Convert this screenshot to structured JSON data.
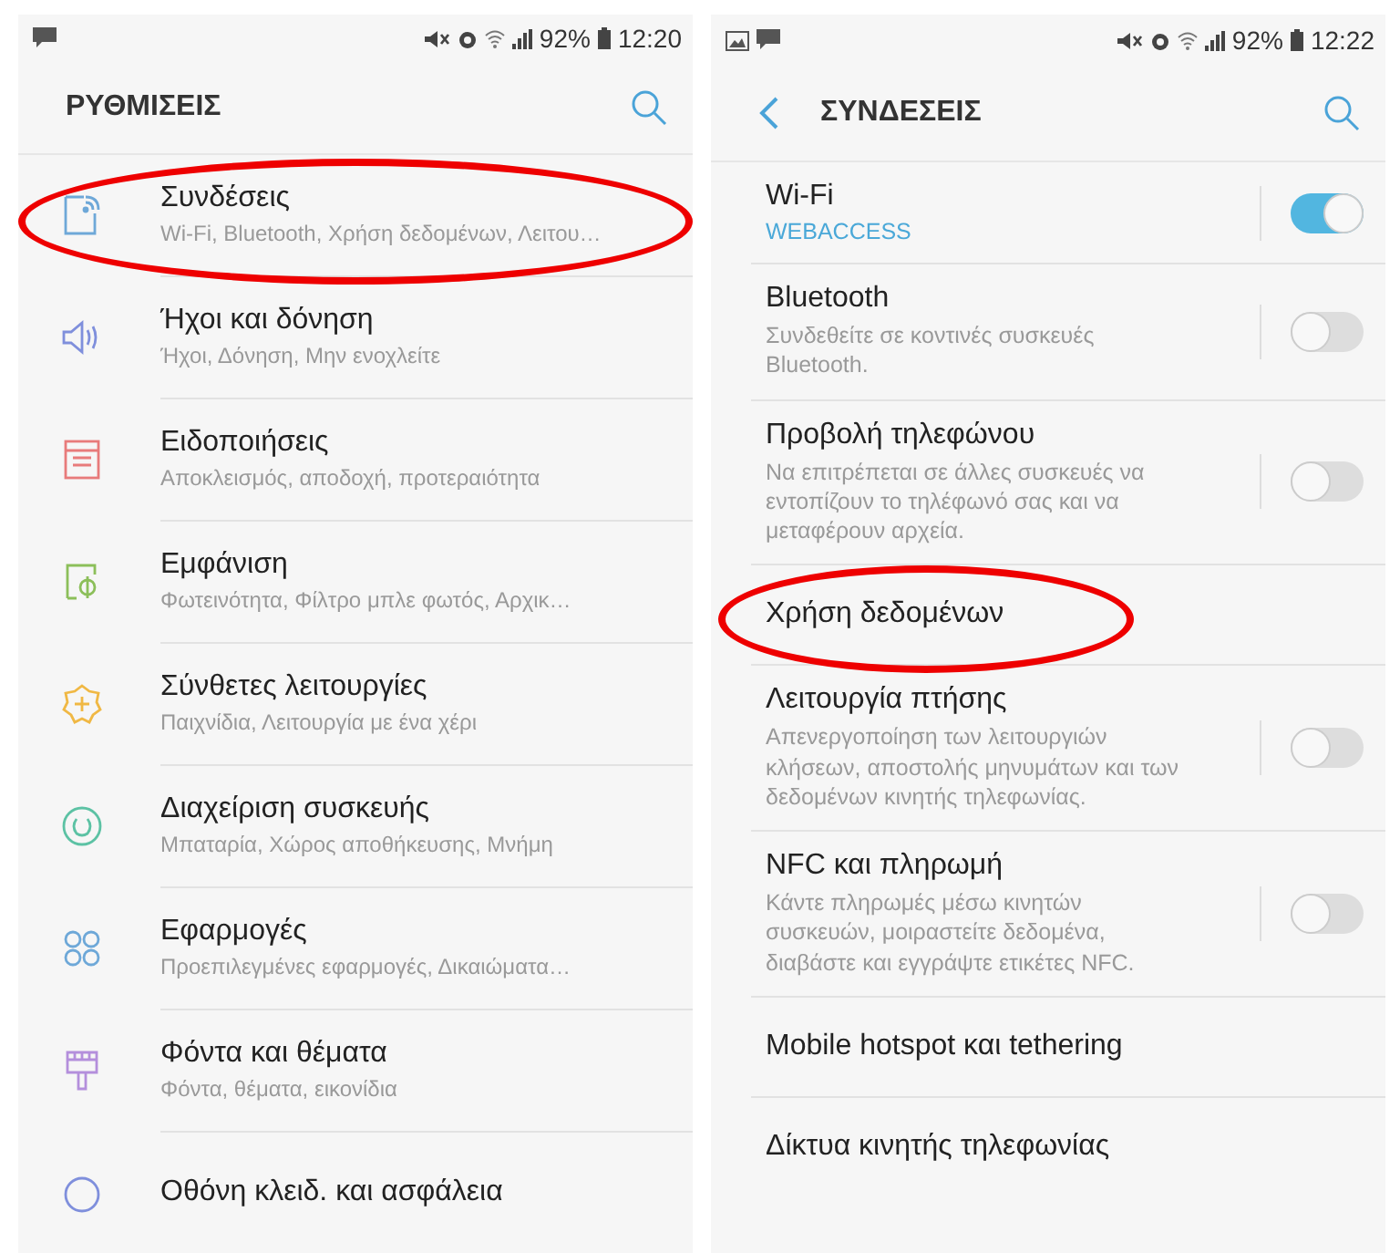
{
  "screens": [
    {
      "status_bar": {
        "battery": "92%",
        "time": "12:20",
        "image_notification": false
      },
      "header": {
        "title": "ΡΥΘΜΙΣΕΙΣ",
        "back": false
      },
      "items": [
        {
          "kind": "category",
          "title": "Συνδέσεις",
          "description": "Wi-Fi, Bluetooth, Χρήση δεδομένων, Λειτου…",
          "color": "#6ea8d8",
          "highlighted": true
        },
        {
          "kind": "category",
          "title": "Ήχοι και δόνηση",
          "description": "Ήχοι, Δόνηση, Μην ενοχλείτε",
          "color": "#7f8fdc",
          "highlighted": false
        },
        {
          "kind": "category",
          "title": "Ειδοποιήσεις",
          "description": "Αποκλεισμός, αποδοχή, προτεραιότητα",
          "color": "#e87b7b",
          "highlighted": false
        },
        {
          "kind": "category",
          "title": "Εμφάνιση",
          "description": "Φωτεινότητα, Φίλτρο μπλε φωτός, Αρχικ…",
          "color": "#8cbf5a",
          "highlighted": false
        },
        {
          "kind": "category",
          "title": "Σύνθετες λειτουργίες",
          "description": "Παιχνίδια, Λειτουργία με ένα χέρι",
          "color": "#f0b844",
          "highlighted": false
        },
        {
          "kind": "category",
          "title": "Διαχείριση συσκευής",
          "description": "Μπαταρία, Χώρος αποθήκευσης, Μνήμη",
          "color": "#5cc2a4",
          "highlighted": false
        },
        {
          "kind": "category",
          "title": "Εφαρμογές",
          "description": "Προεπιλεγμένες εφαρμογές, Δικαιώματα…",
          "color": "#6ea8d8",
          "highlighted": false
        },
        {
          "kind": "category",
          "title": "Φόντα και θέματα",
          "description": "Φόντα, θέματα, εικονίδια",
          "color": "#b48fdc",
          "highlighted": false
        },
        {
          "kind": "category",
          "title": "Οθόνη κλειδ. και ασφάλεια",
          "color": "#7f8fdc",
          "highlighted": false
        }
      ]
    },
    {
      "status_bar": {
        "battery": "92%",
        "time": "12:22",
        "image_notification": true
      },
      "header": {
        "title": "ΣΥΝΔΕΣΕΙΣ",
        "back": true
      },
      "items": [
        {
          "kind": "toggle",
          "title": "Wi-Fi",
          "status": "WEBACCESS",
          "on": true,
          "highlighted": false
        },
        {
          "kind": "toggle",
          "title": "Bluetooth",
          "description": "Συνδεθείτε σε κοντινές συσκευές Bluetooth.",
          "on": false,
          "highlighted": false
        },
        {
          "kind": "toggle",
          "title": "Προβολή τηλεφώνου",
          "description": "Να επιτρέπεται σε άλλες συσκευές να εντοπίζουν το τηλέφωνό σας και να μεταφέρουν αρχεία.",
          "on": false,
          "highlighted": false
        },
        {
          "kind": "link",
          "title": "Χρήση δεδομένων",
          "highlighted": true
        },
        {
          "kind": "toggle",
          "title": "Λειτουργία πτήσης",
          "description": "Απενεργοποίηση των λειτουργιών κλήσεων, αποστολής μηνυμάτων και των δεδομένων κινητής τηλεφωνίας.",
          "on": false,
          "highlighted": false
        },
        {
          "kind": "toggle",
          "title": "NFC και πληρωμή",
          "description": "Κάντε πληρωμές μέσω κινητών συσκευών, μοιραστείτε δεδομένα, διαβάστε και εγγράψτε ετικέτες NFC.",
          "on": false,
          "highlighted": false
        },
        {
          "kind": "link",
          "title": "Mobile hotspot και tethering",
          "highlighted": false
        },
        {
          "kind": "link",
          "title": "Δίκτυα κινητής τηλεφωνίας",
          "highlighted": false
        }
      ]
    }
  ]
}
